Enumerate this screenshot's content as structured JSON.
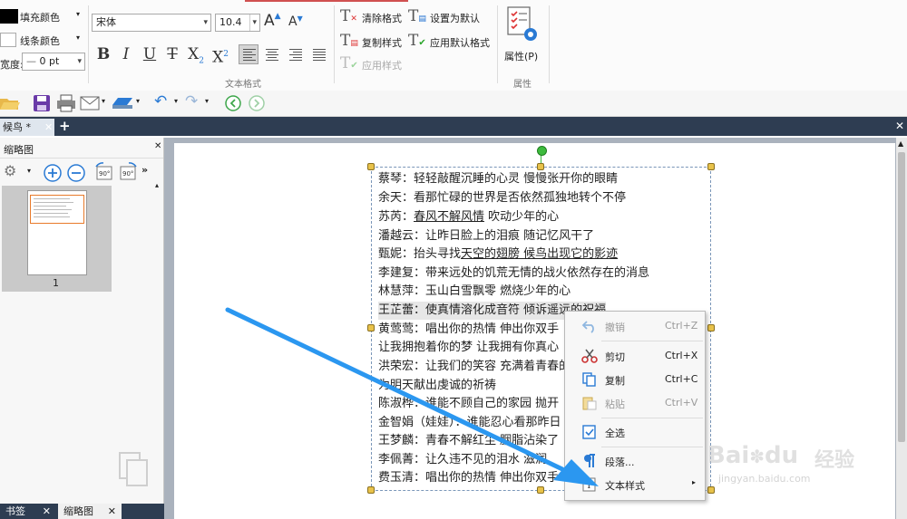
{
  "ribbon": {
    "fill_color_label": "填充颜色",
    "line_color_label": "线条颜色",
    "width_label": "宽度:",
    "width_value": "0 pt",
    "font_name": "宋体",
    "font_size": "10.4",
    "text_format_caption": "文本格式",
    "clear_format": "清除格式",
    "set_default": "设置为默认",
    "copy_style": "复制样式",
    "apply_default_format": "应用默认格式",
    "apply_style": "应用样式",
    "properties_label": "属性(P)",
    "properties_caption": "属性",
    "bold": "B",
    "italic": "I",
    "underline": "U",
    "strike": "T",
    "subscript": "X",
    "superscript": "X",
    "grow_font": "A",
    "shrink_font": "A"
  },
  "tabs": {
    "doc_tab": "候鸟 *"
  },
  "panel": {
    "title": "缩略图",
    "page_number": "1"
  },
  "bottom_tabs": [
    "书签",
    "缩略图"
  ],
  "document": {
    "lines": [
      [
        "蔡琴：轻轻敲醒沉睡的心灵  慢慢张开你的眼睛"
      ],
      [
        "余天：看那忙碌的世界是否依然孤独地转个不停"
      ],
      [
        "苏芮：",
        "春风不解风情",
        "  吹动少年的心"
      ],
      [
        "潘越云：让昨日脸上的泪痕  随记忆风干了"
      ],
      [
        "甄妮：抬头寻找",
        "天空的翅膀  候鸟出现它的影迹"
      ],
      [
        "李建复：带来远处的饥荒无情的战火依然存在的消息"
      ],
      [
        "林慧萍：玉山白雪飘零  燃烧少年的心"
      ],
      [
        "王芷蕾：使真情溶化成音符  倾诉遥远的祝福"
      ],
      [
        "黄莺莺：唱出你的热情  伸出你双手"
      ],
      [
        "让我拥抱着你的梦  让我拥有你真心"
      ],
      [
        "洪荣宏：让我们的笑容  充满着青春的"
      ],
      [
        "为明天献出虔诚的祈祷"
      ],
      [
        "陈淑桦：谁能不顾自己的家园  抛开"
      ],
      [
        "金智娟（娃娃）：谁能忍心看那昨日"
      ],
      [
        "王梦麟：青春不解红尘  胭脂沾染了"
      ],
      [
        "李佩菁：让久违不见的泪水  滋润"
      ],
      [
        "费玉清：唱出你的热情  伸出你双手"
      ]
    ]
  },
  "context_menu": {
    "items": [
      {
        "label": "撤销",
        "shortcut": "Ctrl+Z",
        "enabled": false,
        "icon": "undo-icon"
      },
      {
        "label": "剪切",
        "shortcut": "Ctrl+X",
        "enabled": true,
        "icon": "scissors-icon"
      },
      {
        "label": "复制",
        "shortcut": "Ctrl+C",
        "enabled": true,
        "icon": "copy-icon"
      },
      {
        "label": "粘贴",
        "shortcut": "Ctrl+V",
        "enabled": false,
        "icon": "paste-icon"
      },
      {
        "label": "全选",
        "shortcut": "",
        "enabled": true,
        "icon": "select-all-icon"
      },
      {
        "label": "段落...",
        "shortcut": "",
        "enabled": true,
        "icon": "paragraph-icon"
      },
      {
        "label": "文本样式",
        "shortcut": "",
        "enabled": true,
        "icon": "text-style-icon",
        "submenu": true
      }
    ]
  },
  "watermark": {
    "brand": "Bai",
    "brand2": "du",
    "cn": "经验",
    "url": "jingyan.baidu.com"
  },
  "colors": {
    "arrow": "#2b97f0",
    "tab_bar": "#2e3d52",
    "accent_blue": "#1e6fd0",
    "handle": "#e8c24a",
    "rotate_handle": "#3dbb3d"
  }
}
